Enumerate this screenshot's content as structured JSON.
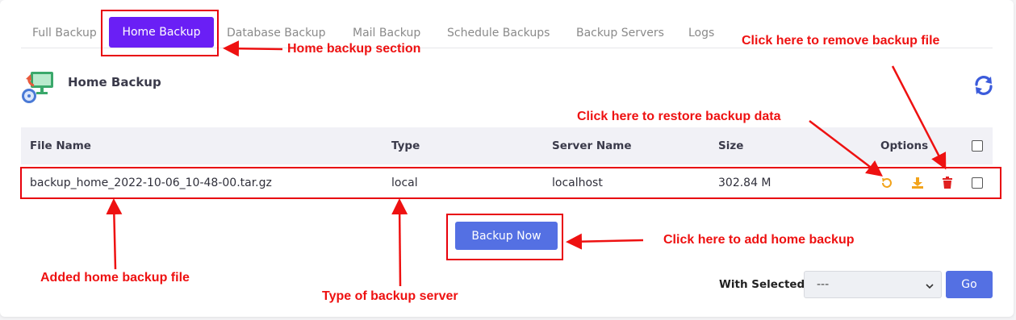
{
  "tabs": [
    {
      "label": "Full Backup",
      "active": false
    },
    {
      "label": "Home Backup",
      "active": true
    },
    {
      "label": "Database Backup",
      "active": false
    },
    {
      "label": "Mail Backup",
      "active": false
    },
    {
      "label": "Schedule Backups",
      "active": false
    },
    {
      "label": "Backup Servers",
      "active": false
    },
    {
      "label": "Logs",
      "active": false
    }
  ],
  "section": {
    "title": "Home Backup",
    "icon": "backup-icon",
    "refresh_icon": "refresh-icon"
  },
  "table": {
    "columns": [
      "File Name",
      "Type",
      "Server Name",
      "Size",
      "Options"
    ],
    "rows": [
      {
        "file_name": "backup_home_2022-10-06_10-48-00.tar.gz",
        "type": "local",
        "server_name": "localhost",
        "size": "302.84 M",
        "options": [
          "restore-icon",
          "download-icon",
          "trash-icon"
        ],
        "selected": false
      }
    ],
    "select_all": false
  },
  "actions": {
    "backup_now_label": "Backup Now"
  },
  "bulk": {
    "with_selected_label": "With Selected:",
    "selected_value": "---",
    "go_label": "Go"
  },
  "annotations": {
    "home_section": "Home backup section",
    "remove": "Click here to remove backup file",
    "restore": "Click here to restore backup data",
    "add": "Click here to add home backup",
    "added_file": "Added home backup file",
    "type_server": "Type of backup server"
  },
  "colors": {
    "accent_tab": "#6a1ff5",
    "primary_button": "#5470e3",
    "annotation": "#ee1111",
    "restore": "#f2a31b",
    "download": "#f2a31b",
    "trash": "#e02020",
    "refresh": "#3b5bdb"
  }
}
